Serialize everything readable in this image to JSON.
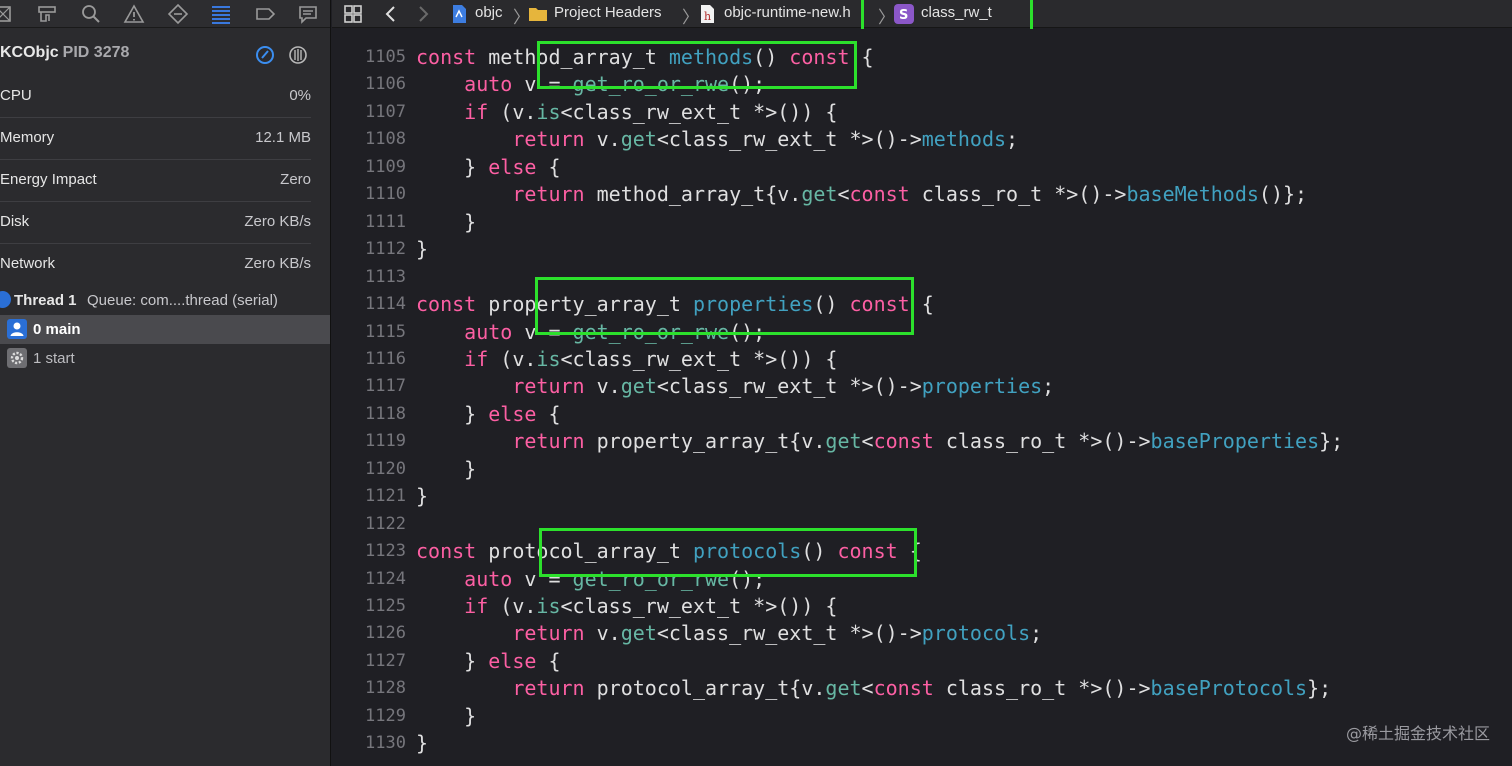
{
  "navigator": {
    "process": {
      "name": "KCObjc",
      "pid": "PID 3278"
    },
    "metrics": [
      {
        "label": "CPU",
        "value": "0%"
      },
      {
        "label": "Memory",
        "value": "12.1 MB"
      },
      {
        "label": "Energy Impact",
        "value": "Zero"
      },
      {
        "label": "Disk",
        "value": "Zero KB/s"
      },
      {
        "label": "Network",
        "value": "Zero KB/s"
      }
    ],
    "thread": {
      "name": "Thread 1",
      "queue": "Queue: com....thread (serial)"
    },
    "frames": [
      {
        "label": "0 main",
        "selected": true
      },
      {
        "label": "1 start",
        "selected": false
      }
    ]
  },
  "jumpbar": {
    "items": [
      "objc",
      "Project Headers",
      "objc-runtime-new.h",
      "class_rw_t"
    ]
  },
  "code": {
    "lines": [
      {
        "n": "1105",
        "t": [
          [
            "kw",
            "const "
          ],
          [
            "tp",
            "method_array_t "
          ],
          [
            "mb",
            "methods"
          ],
          [
            "tp",
            "() "
          ],
          [
            "kw",
            "const "
          ],
          [
            "tp",
            "{"
          ]
        ]
      },
      {
        "n": "1106",
        "t": [
          [
            "kw",
            "    auto "
          ],
          [
            "tp",
            "v = "
          ],
          [
            "fn",
            "get_ro_or_rwe"
          ],
          [
            "tp",
            "();"
          ]
        ]
      },
      {
        "n": "1107",
        "t": [
          [
            "kw",
            "    if "
          ],
          [
            "tp",
            "(v."
          ],
          [
            "fn",
            "is"
          ],
          [
            "tp",
            "<class_rw_ext_t *>()) {"
          ]
        ]
      },
      {
        "n": "1108",
        "t": [
          [
            "kw",
            "        return "
          ],
          [
            "tp",
            "v."
          ],
          [
            "fn",
            "get"
          ],
          [
            "tp",
            "<class_rw_ext_t *>()->"
          ],
          [
            "mb",
            "methods"
          ],
          [
            "tp",
            ";"
          ]
        ]
      },
      {
        "n": "1109",
        "t": [
          [
            "tp",
            "    } "
          ],
          [
            "kw",
            "else "
          ],
          [
            "tp",
            "{"
          ]
        ]
      },
      {
        "n": "1110",
        "t": [
          [
            "kw",
            "        return "
          ],
          [
            "tp",
            "method_array_t{v."
          ],
          [
            "fn",
            "get"
          ],
          [
            "tp",
            "<"
          ],
          [
            "kw",
            "const "
          ],
          [
            "tp",
            "class_ro_t *>()->"
          ],
          [
            "mb",
            "baseMethods"
          ],
          [
            "tp",
            "()};"
          ]
        ]
      },
      {
        "n": "1111",
        "t": [
          [
            "tp",
            "    }"
          ]
        ]
      },
      {
        "n": "1112",
        "t": [
          [
            "tp",
            "}"
          ]
        ]
      },
      {
        "n": "1113",
        "t": []
      },
      {
        "n": "1114",
        "t": [
          [
            "kw",
            "const "
          ],
          [
            "tp",
            "property_array_t "
          ],
          [
            "mb",
            "properties"
          ],
          [
            "tp",
            "() "
          ],
          [
            "kw",
            "const "
          ],
          [
            "tp",
            "{"
          ]
        ]
      },
      {
        "n": "1115",
        "t": [
          [
            "kw",
            "    auto "
          ],
          [
            "tp",
            "v = "
          ],
          [
            "fn",
            "get_ro_or_rwe"
          ],
          [
            "tp",
            "();"
          ]
        ]
      },
      {
        "n": "1116",
        "t": [
          [
            "kw",
            "    if "
          ],
          [
            "tp",
            "(v."
          ],
          [
            "fn",
            "is"
          ],
          [
            "tp",
            "<class_rw_ext_t *>()) {"
          ]
        ]
      },
      {
        "n": "1117",
        "t": [
          [
            "kw",
            "        return "
          ],
          [
            "tp",
            "v."
          ],
          [
            "fn",
            "get"
          ],
          [
            "tp",
            "<class_rw_ext_t *>()->"
          ],
          [
            "mb",
            "properties"
          ],
          [
            "tp",
            ";"
          ]
        ]
      },
      {
        "n": "1118",
        "t": [
          [
            "tp",
            "    } "
          ],
          [
            "kw",
            "else "
          ],
          [
            "tp",
            "{"
          ]
        ]
      },
      {
        "n": "1119",
        "t": [
          [
            "kw",
            "        return "
          ],
          [
            "tp",
            "property_array_t{v."
          ],
          [
            "fn",
            "get"
          ],
          [
            "tp",
            "<"
          ],
          [
            "kw",
            "const "
          ],
          [
            "tp",
            "class_ro_t *>()->"
          ],
          [
            "mb",
            "baseProperties"
          ],
          [
            "tp",
            "};"
          ]
        ]
      },
      {
        "n": "1120",
        "t": [
          [
            "tp",
            "    }"
          ]
        ]
      },
      {
        "n": "1121",
        "t": [
          [
            "tp",
            "}"
          ]
        ]
      },
      {
        "n": "1122",
        "t": []
      },
      {
        "n": "1123",
        "t": [
          [
            "kw",
            "const "
          ],
          [
            "tp",
            "protocol_array_t "
          ],
          [
            "mb",
            "protocols"
          ],
          [
            "tp",
            "() "
          ],
          [
            "kw",
            "const "
          ],
          [
            "tp",
            "{"
          ]
        ]
      },
      {
        "n": "1124",
        "t": [
          [
            "kw",
            "    auto "
          ],
          [
            "tp",
            "v = "
          ],
          [
            "fn",
            "get_ro_or_rwe"
          ],
          [
            "tp",
            "();"
          ]
        ]
      },
      {
        "n": "1125",
        "t": [
          [
            "kw",
            "    if "
          ],
          [
            "tp",
            "(v."
          ],
          [
            "fn",
            "is"
          ],
          [
            "tp",
            "<class_rw_ext_t *>()) {"
          ]
        ]
      },
      {
        "n": "1126",
        "t": [
          [
            "kw",
            "        return "
          ],
          [
            "tp",
            "v."
          ],
          [
            "fn",
            "get"
          ],
          [
            "tp",
            "<class_rw_ext_t *>()->"
          ],
          [
            "mb",
            "protocols"
          ],
          [
            "tp",
            ";"
          ]
        ]
      },
      {
        "n": "1127",
        "t": [
          [
            "tp",
            "    } "
          ],
          [
            "kw",
            "else "
          ],
          [
            "tp",
            "{"
          ]
        ]
      },
      {
        "n": "1128",
        "t": [
          [
            "kw",
            "        return "
          ],
          [
            "tp",
            "protocol_array_t{v."
          ],
          [
            "fn",
            "get"
          ],
          [
            "tp",
            "<"
          ],
          [
            "kw",
            "const "
          ],
          [
            "tp",
            "class_ro_t *>()->"
          ],
          [
            "mb",
            "baseProtocols"
          ],
          [
            "tp",
            "};"
          ]
        ]
      },
      {
        "n": "1129",
        "t": [
          [
            "tp",
            "    }"
          ]
        ]
      },
      {
        "n": "1130",
        "t": [
          [
            "tp",
            "}"
          ]
        ]
      }
    ]
  },
  "watermark": "@稀土掘金技术社区",
  "colors": {
    "highlight_box": "#2ce02c",
    "keyword": "#fc5fa3",
    "function": "#67b7a4",
    "member": "#41a1c0"
  }
}
